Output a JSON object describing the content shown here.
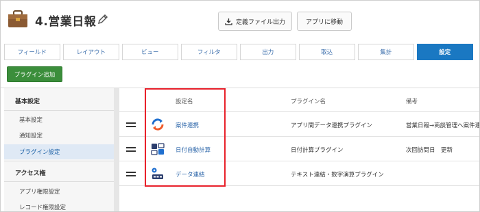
{
  "header": {
    "app_title": "4.営業日報",
    "export_button": "定義ファイル出力",
    "move_button": "アプリに移動"
  },
  "tabs": [
    {
      "label": "フィールド"
    },
    {
      "label": "レイアウト"
    },
    {
      "label": "ビュー"
    },
    {
      "label": "フィルタ"
    },
    {
      "label": "出力"
    },
    {
      "label": "取込"
    },
    {
      "label": "集計"
    },
    {
      "label": "設定",
      "active": true
    }
  ],
  "add_plugin_button": "プラグイン追加",
  "sidebar": {
    "section1": "基本設定",
    "items1": [
      "基本設定",
      "通知設定",
      "プラグイン設定"
    ],
    "section2": "アクセス権",
    "items2": [
      "アプリ権限設定",
      "レコード権限設定"
    ]
  },
  "table": {
    "headers": {
      "name": "設定名",
      "plugin": "プラグイン名",
      "note": "備考"
    },
    "rows": [
      {
        "name": "案件連携",
        "plugin": "アプリ間データ連携プラグイン",
        "note": "営業日報→商談管理へ案件連",
        "icon": "sync-icon"
      },
      {
        "name": "日付自動計算",
        "plugin": "日付計算プラグイン",
        "note": "次回訪問日　更新",
        "icon": "date-calc-icon"
      },
      {
        "name": "データ連結",
        "plugin": "テキスト連結・数字演算プラグイン",
        "note": "",
        "icon": "data-concat-icon"
      }
    ]
  },
  "colors": {
    "accent": "#1a78c2",
    "green": "#3b8e3b",
    "highlight": "#e8202a"
  }
}
